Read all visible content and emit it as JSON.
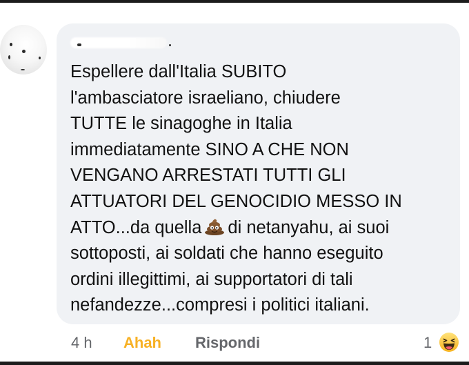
{
  "comment": {
    "author": "",
    "text_before_emoji": "Espellere dall'Italia SUBITO\nl'ambasciatore israeliano, chiudere\nTUTTE le sinagoghe in Italia\nimmediatamente SINO A CHE NON\nVENGANO ARRESTATI TUTTI GLI\nATTUATORI DEL GENOCIDIO MESSO IN\nATTO...da quella",
    "emoji": "pile-of-poo-icon",
    "text_after_emoji": "di netanyahu, ai suoi\nsottoposti, ai soldati che hanno eseguito\nordini illegittimi, ai supportatori di tali\nnefandezze...compresi i politici italiani."
  },
  "actions": {
    "time": "4 h",
    "reaction_label": "Ahah",
    "reply_label": "Rispondi"
  },
  "reactions": {
    "count": "1",
    "icon": "haha-icon"
  },
  "colors": {
    "bubble": "#f0f2f5",
    "text": "#111111",
    "meta": "#65676b",
    "haha": "#f7b125"
  }
}
